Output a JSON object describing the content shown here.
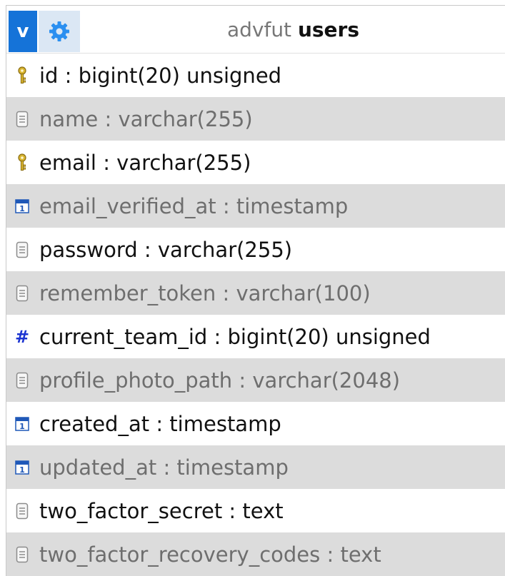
{
  "header": {
    "view_button": "v",
    "settings_icon": "gear-icon",
    "database": "advfut",
    "table": "users"
  },
  "columns": [
    {
      "text": "id : bigint(20) unsigned",
      "icon": "key-icon"
    },
    {
      "text": "name : varchar(255)",
      "icon": "text-field-icon"
    },
    {
      "text": "email : varchar(255)",
      "icon": "key-icon"
    },
    {
      "text": "email_verified_at : timestamp",
      "icon": "calendar-icon"
    },
    {
      "text": "password : varchar(255)",
      "icon": "text-field-icon"
    },
    {
      "text": "remember_token : varchar(100)",
      "icon": "text-field-icon"
    },
    {
      "text": "current_team_id : bigint(20) unsigned",
      "icon": "hash-icon"
    },
    {
      "text": "profile_photo_path : varchar(2048)",
      "icon": "text-field-icon"
    },
    {
      "text": "created_at : timestamp",
      "icon": "calendar-icon"
    },
    {
      "text": "updated_at : timestamp",
      "icon": "calendar-icon"
    },
    {
      "text": "two_factor_secret : text",
      "icon": "text-field-icon"
    },
    {
      "text": "two_factor_recovery_codes : text",
      "icon": "text-field-icon"
    }
  ],
  "colors": {
    "accent": "#1573d8",
    "gear_bg": "#dbe7f4",
    "row_alt": "#dcdcdc"
  }
}
